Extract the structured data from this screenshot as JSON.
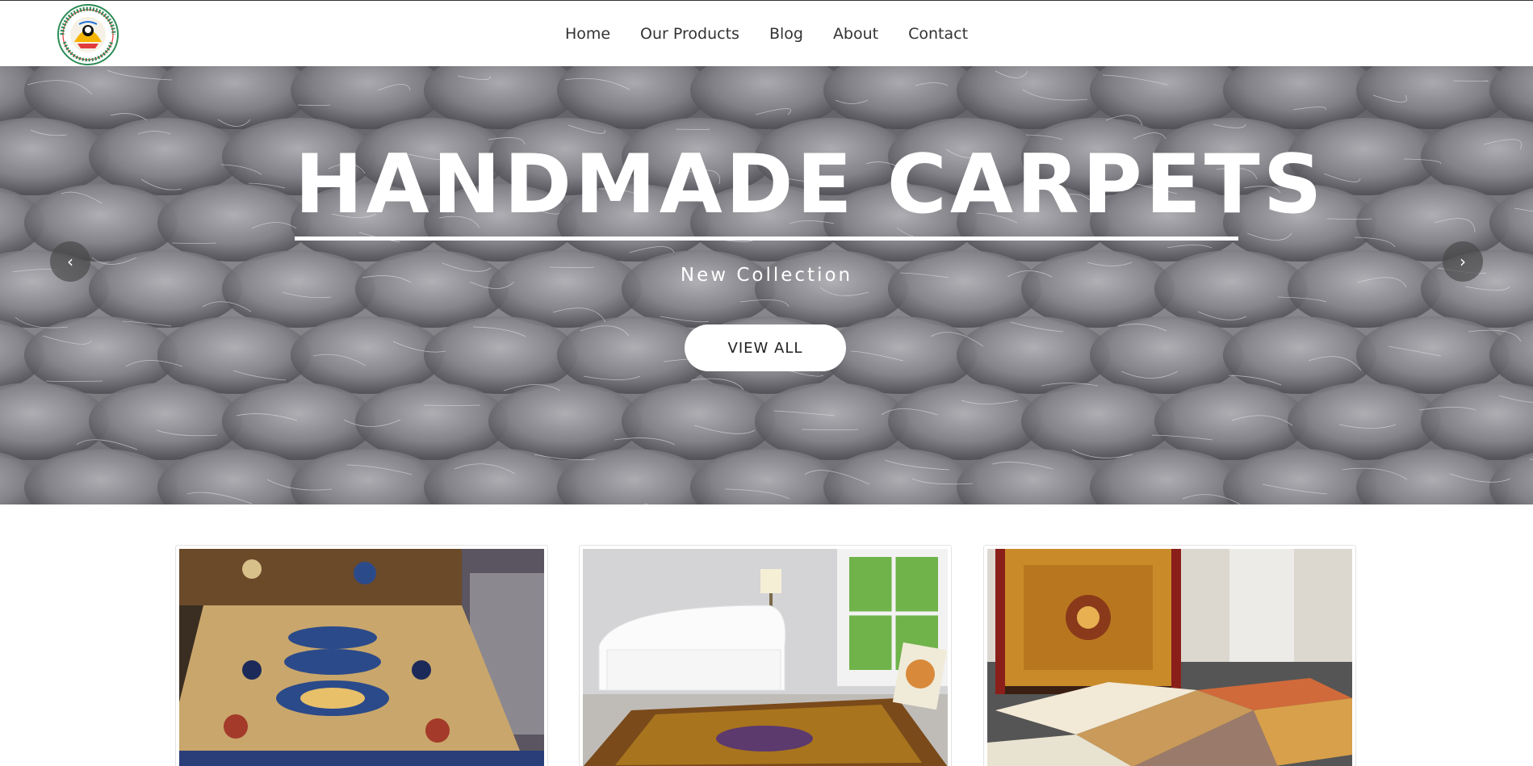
{
  "brand": {
    "logo_text_top": "HIMALAYA JASMINE HANDICRAFT PVT. LTD.",
    "logo_text_bottom": "KATHMANDU, NEPAL"
  },
  "nav": {
    "items": [
      "Home",
      "Our Products",
      "Blog",
      "About",
      "Contact"
    ]
  },
  "hero": {
    "title": "HANDMADE CARPETS",
    "subtitle": "New Collection",
    "button": "VIEW ALL",
    "prev_arrow": "‹",
    "next_arrow": "›"
  },
  "products": [
    {
      "image": "tibetan-dragon-carpet"
    },
    {
      "image": "living-room-carpet"
    },
    {
      "image": "carpet-showroom"
    }
  ],
  "colors": {
    "text": "#333333",
    "button_bg": "#ffffff",
    "hero_overlay_text": "#ffffff"
  }
}
